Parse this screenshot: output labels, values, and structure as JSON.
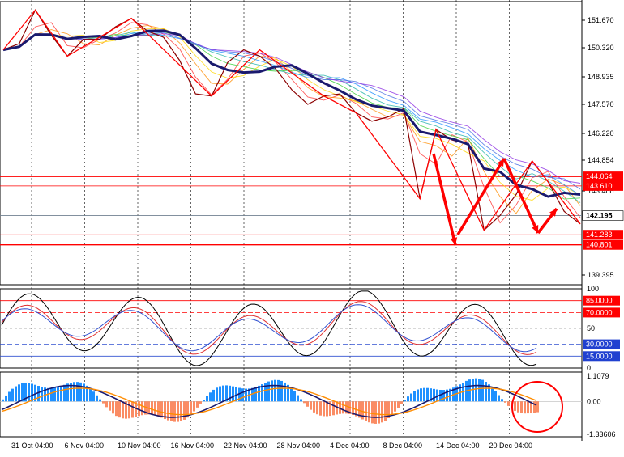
{
  "chart_data": [
    {
      "type": "line",
      "name": "price",
      "y_axis_labels": [
        "151.670",
        "150.320",
        "148.935",
        "147.570",
        "146.220",
        "144.854",
        "143.488",
        "139.395"
      ],
      "price_levels": [
        "144.064",
        "143.610",
        "142.195",
        "141.283",
        "140.801"
      ],
      "x_axis_labels": [
        "31 Oct 04:00",
        "6 Nov 04:00",
        "10 Nov 04:00",
        "16 Nov 04:00",
        "22 Nov 04:00",
        "28 Nov 04:00",
        "4 Dec 04:00",
        "8 Dec 04:00",
        "14 Dec 04:00",
        "20 Dec 04:00"
      ],
      "ylim": [
        138.9,
        152.4
      ],
      "close_path": [
        150.1,
        150.4,
        152.0,
        150.8,
        149.8,
        150.6,
        150.6,
        151.2,
        151.6,
        151.0,
        150.7,
        149.6,
        148.0,
        147.9,
        149.5,
        150.1,
        149.8,
        149.2,
        148.2,
        147.5,
        147.9,
        148.0,
        147.1,
        146.7,
        146.9,
        147.3,
        143.0,
        146.3,
        145.8,
        145.6,
        141.5,
        142.2,
        143.2,
        144.8,
        143.8,
        142.4,
        141.8
      ]
    },
    {
      "type": "line",
      "name": "oscillator",
      "y_axis_labels": [
        "100",
        "85.0000",
        "70.0000",
        "50",
        "30.0000",
        "15.0000",
        "0"
      ],
      "levels": [
        85,
        70,
        50,
        30,
        15
      ],
      "ylim": [
        0,
        100
      ]
    },
    {
      "type": "bar",
      "name": "macd",
      "y_axis_labels": [
        "1.1079",
        "0.00",
        "-1.33606"
      ],
      "ylim": [
        -1.33606,
        1.1079
      ]
    }
  ],
  "colors": {
    "level_red": "#ff0000",
    "ma_blue": "#1a1a6e",
    "up_blue": "#1e90ff",
    "down_salmon": "#fa8c64",
    "osc_black": "#000000",
    "osc_red": "#e03030",
    "osc_blue": "#3050d0",
    "signal_orange": "#ff8c00",
    "highlight_marker": "#ff0000"
  }
}
